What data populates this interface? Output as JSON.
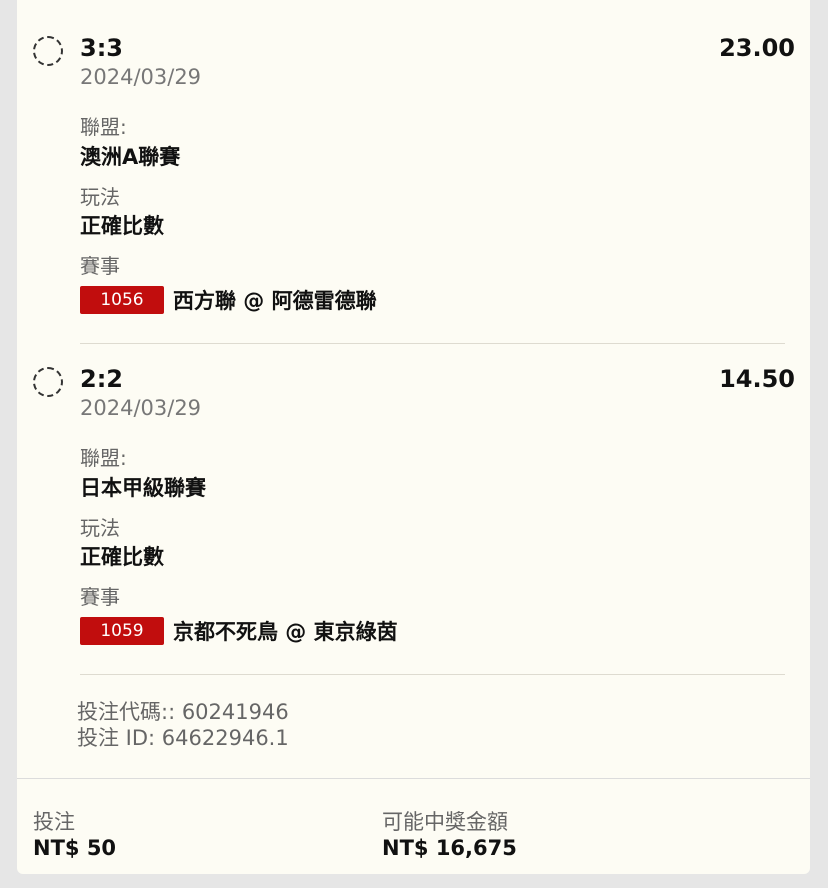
{
  "bets": [
    {
      "score": "3:3",
      "odds": "23.00",
      "date": "2024/03/29",
      "league_label": "聯盟:",
      "league": "澳洲A聯賽",
      "market_label": "玩法",
      "market": "正確比數",
      "event_label": "賽事",
      "event_id": "1056",
      "match": "西方聯 @ 阿德雷德聯"
    },
    {
      "score": "2:2",
      "odds": "14.50",
      "date": "2024/03/29",
      "league_label": "聯盟:",
      "league": "日本甲級聯賽",
      "market_label": "玩法",
      "market": "正確比數",
      "event_label": "賽事",
      "event_id": "1059",
      "match": "京都不死鳥 @ 東京綠茵"
    }
  ],
  "ticket": {
    "code_line": "投注代碼:: 60241946",
    "id_line": "投注 ID: 64622946.1"
  },
  "footer": {
    "stake_label": "投注",
    "stake_value": "NT$ 50",
    "payout_label": "可能中獎金額",
    "payout_value": "NT$ 16,675"
  },
  "colors": {
    "card_bg": "#fdfcf4",
    "page_bg": "#e6e6e6",
    "badge": "#c10d0d"
  }
}
